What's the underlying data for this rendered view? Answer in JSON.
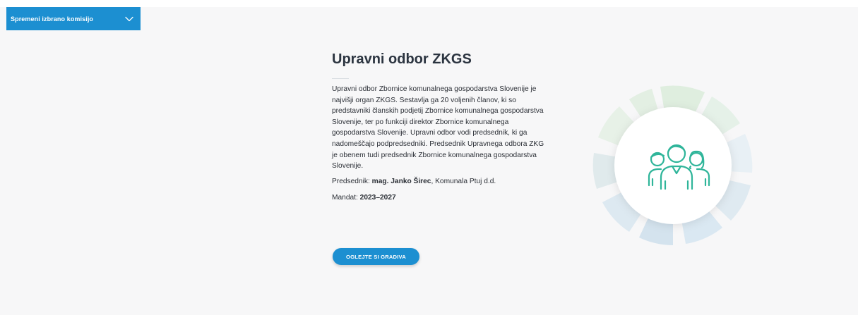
{
  "committee_selector": {
    "label": "Spremeni izbrano komisijo"
  },
  "main": {
    "title": "Upravni odbor ZKGS",
    "description": "Upravni odbor Zbornice komunalnega gospodarstva Slovenije je najvišji organ ZKGS. Sestavlja ga 20 voljenih članov, ki so predstavniki članskih podjetij Zbornice komunalnega gospodarstva Slovenije, ter po funkciji direktor Zbornice komunalnega gospodarstva Slovenije. Upravni odbor vodi predsednik, ki ga nadomeščajo podpredsedniki. Predsednik Upravnega odbora ZKG je obenem tudi predsednik Zbornice komunalnega gospodarstva Slovenije.",
    "president_label": "Predsednik:",
    "president_name": "mag. Janko Širec",
    "president_company": ", Komunala Ptuj d.d.",
    "mandate_label": "Mandat:",
    "mandate_value": "2023–2027",
    "cta_label": "OGLEJTE SI GRADIVA"
  },
  "icons": {
    "dropdown": "chevron-down-icon",
    "group": "people-group-icon"
  },
  "colors": {
    "accent": "#1c8fd1",
    "icon_teal": "#2fb59a",
    "background": "#f7f7f8"
  }
}
